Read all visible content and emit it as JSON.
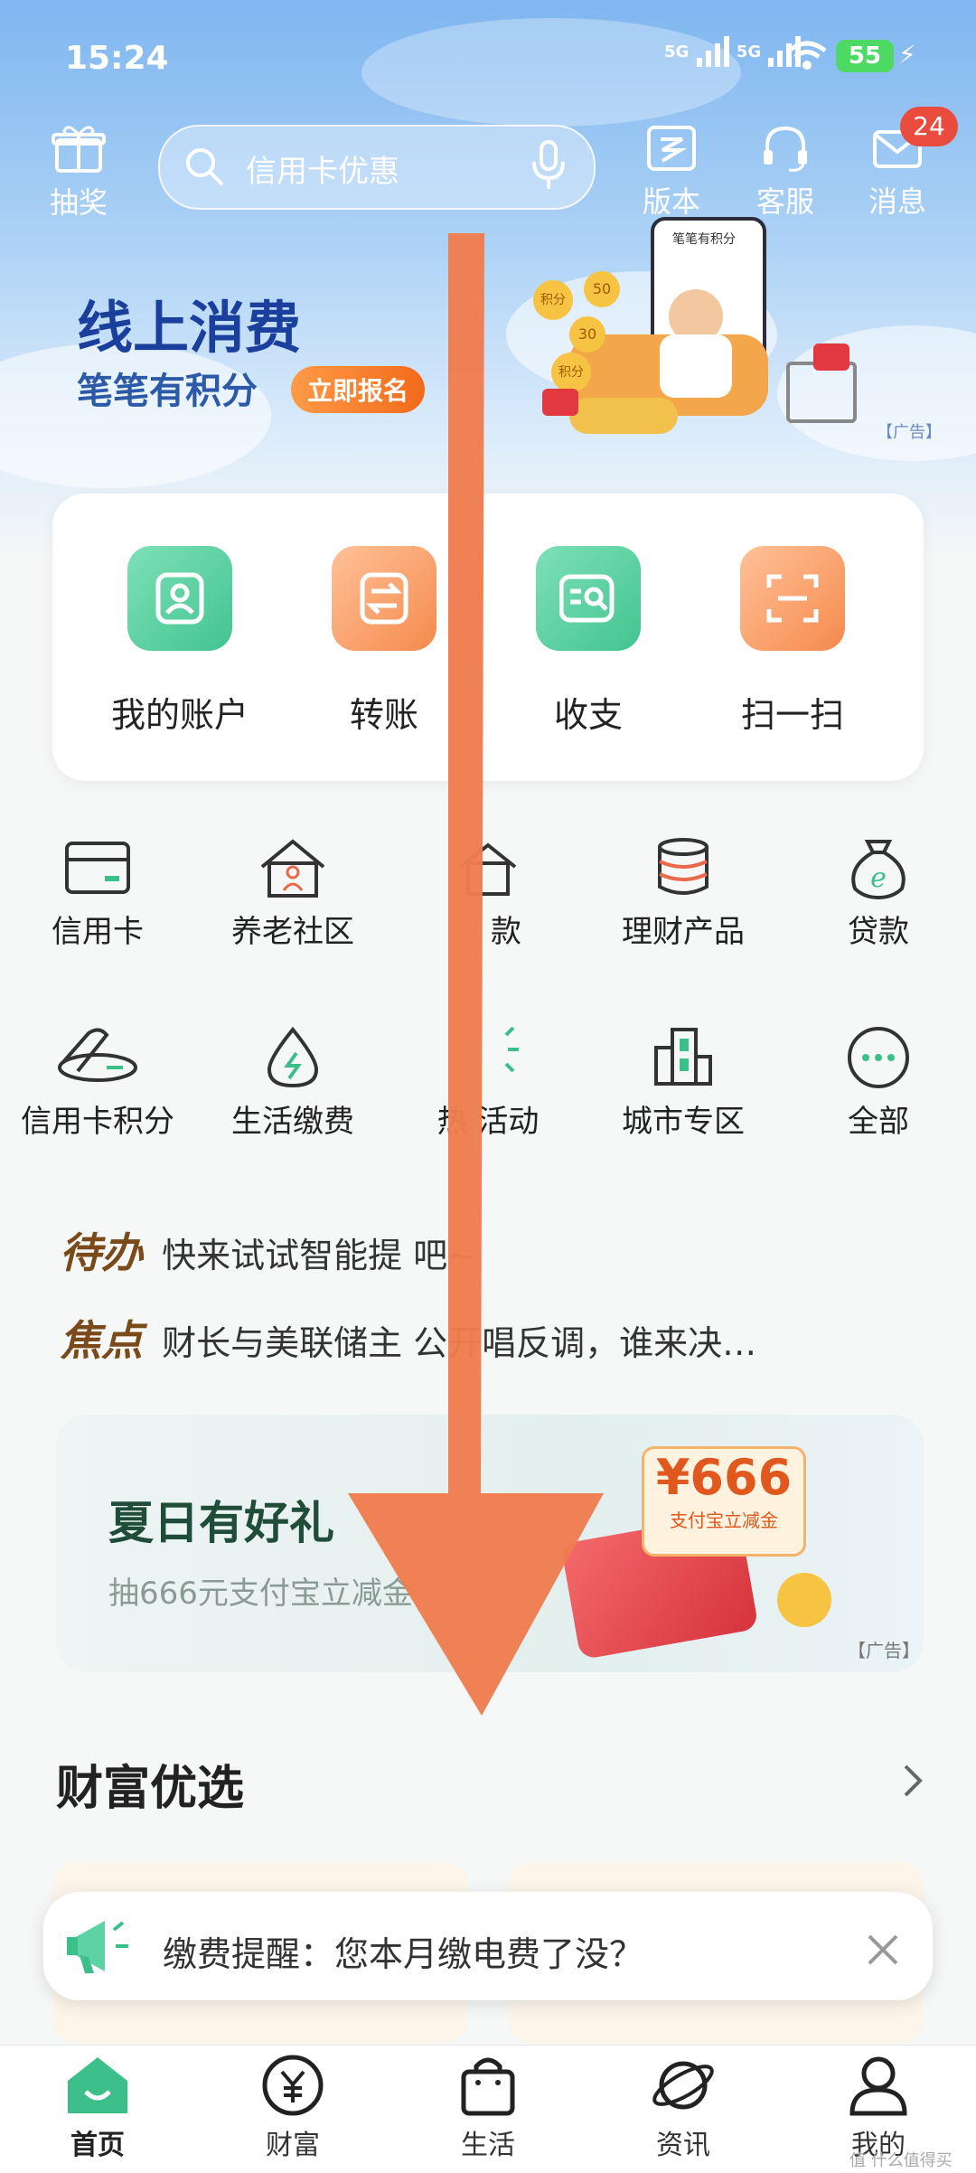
{
  "status": {
    "time": "15:24",
    "signal1": "5G",
    "signal2": "5G",
    "battery": "55"
  },
  "header": {
    "lottery_label": "抽奖",
    "search_placeholder": "信用卡优惠",
    "version_label": "版本",
    "service_label": "客服",
    "message_label": "消息",
    "message_badge": "24"
  },
  "banner": {
    "title": "线上消费",
    "subtitle": "笔笔有积分",
    "button": "立即报名",
    "ad_tag": "【广告】",
    "phone_text": "笔笔有积分",
    "coin1": "积分",
    "coin2": "50",
    "coin3": "30",
    "coin4": "积分"
  },
  "main_actions": [
    {
      "label": "我的账户"
    },
    {
      "label": "转账"
    },
    {
      "label": "收支"
    },
    {
      "label": "扫一扫"
    }
  ],
  "grid_row1": [
    {
      "label": "信用卡"
    },
    {
      "label": "养老社区"
    },
    {
      "label": "款"
    },
    {
      "label": "理财产品"
    },
    {
      "label": "贷款"
    }
  ],
  "grid_row2": [
    {
      "label": "信用卡积分"
    },
    {
      "label": "生活缴费"
    },
    {
      "label": "热 活动"
    },
    {
      "label": "城市专区"
    },
    {
      "label": "全部"
    }
  ],
  "todo": {
    "tag": "待办",
    "text": "快来试试智能提 吧~"
  },
  "focus": {
    "tag": "焦点",
    "text": "财长与美联储主 公开唱反调，谁来决…"
  },
  "promo": {
    "title": "夏日有好礼",
    "subtitle": "抽666元支付宝立减金",
    "amount": "¥666",
    "amount_sub": "支付宝立减金",
    "ad_tag": "【广告】"
  },
  "wealth": {
    "title": "财富优选"
  },
  "notice": {
    "text": "缴费提醒：您本月缴电费了没？"
  },
  "tabs": [
    {
      "label": "首页"
    },
    {
      "label": "财富"
    },
    {
      "label": "生活"
    },
    {
      "label": "资讯"
    },
    {
      "label": "我的"
    }
  ],
  "watermark": "值 什么值得买",
  "colors": {
    "accent": "#3dbf8a",
    "arrow": "#ee7d4f",
    "banner_title": "#1b3f9c"
  }
}
